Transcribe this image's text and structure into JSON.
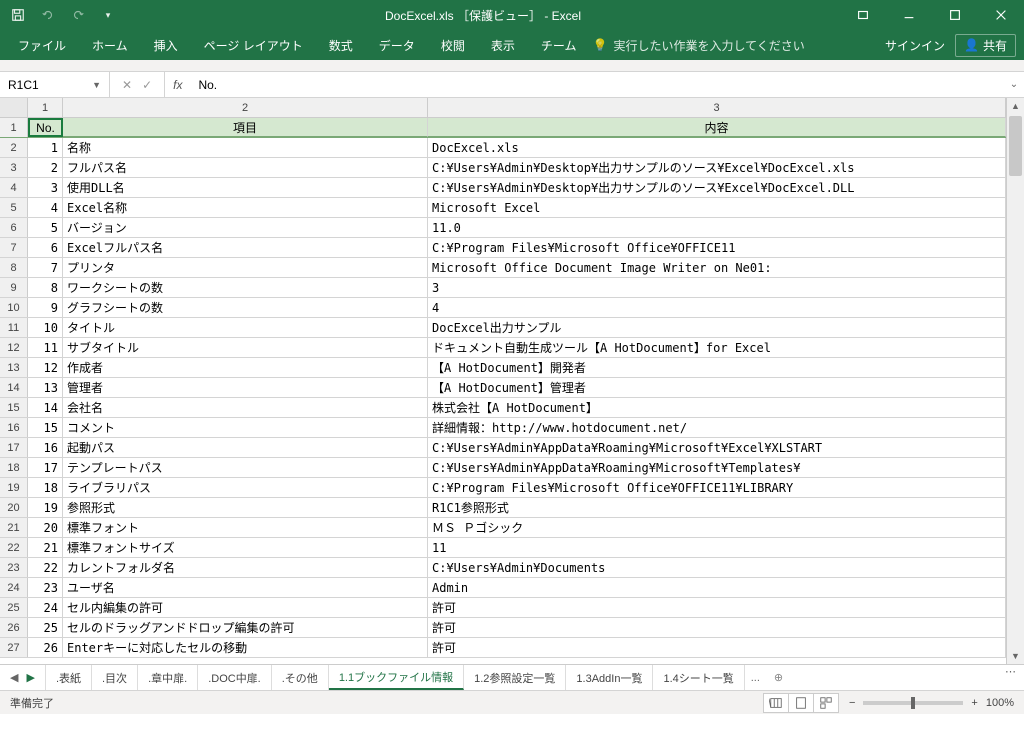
{
  "title": "DocExcel.xls ［保護ビュー］ - Excel",
  "qat": {
    "undo": "↶",
    "redo": "↷"
  },
  "tabs": [
    "ファイル",
    "ホーム",
    "挿入",
    "ページ レイアウト",
    "数式",
    "データ",
    "校閲",
    "表示",
    "チーム"
  ],
  "tell_me": "実行したい作業を入力してください",
  "signin": "サインイン",
  "share": "共有",
  "namebox": "R1C1",
  "fx_label": "fx",
  "formula": "No.",
  "col_headers": [
    "1",
    "2",
    "3"
  ],
  "header_row": {
    "no": "No.",
    "item": "項目",
    "content": "内容"
  },
  "rows": [
    {
      "n": "1",
      "item": "名称",
      "val": "DocExcel.xls"
    },
    {
      "n": "2",
      "item": "フルパス名",
      "val": "C:¥Users¥Admin¥Desktop¥出力サンプルのソース¥Excel¥DocExcel.xls"
    },
    {
      "n": "3",
      "item": "使用DLL名",
      "val": "C:¥Users¥Admin¥Desktop¥出力サンプルのソース¥Excel¥DocExcel.DLL"
    },
    {
      "n": "4",
      "item": "Excel名称",
      "val": "Microsoft Excel"
    },
    {
      "n": "5",
      "item": "バージョン",
      "val": "11.0"
    },
    {
      "n": "6",
      "item": "Excelフルパス名",
      "val": "C:¥Program Files¥Microsoft Office¥OFFICE11"
    },
    {
      "n": "7",
      "item": "プリンタ",
      "val": "Microsoft Office Document Image Writer on Ne01:"
    },
    {
      "n": "8",
      "item": "ワークシートの数",
      "val": "3"
    },
    {
      "n": "9",
      "item": "グラフシートの数",
      "val": "4"
    },
    {
      "n": "10",
      "item": "タイトル",
      "val": "DocExcel出力サンプル"
    },
    {
      "n": "11",
      "item": "サブタイトル",
      "val": "ドキュメント自動生成ツール【A HotDocument】for Excel"
    },
    {
      "n": "12",
      "item": "作成者",
      "val": "【A HotDocument】開発者"
    },
    {
      "n": "13",
      "item": "管理者",
      "val": "【A HotDocument】管理者"
    },
    {
      "n": "14",
      "item": "会社名",
      "val": "株式会社【A HotDocument】"
    },
    {
      "n": "15",
      "item": "コメント",
      "val": "詳細情報：http://www.hotdocument.net/"
    },
    {
      "n": "16",
      "item": "起動パス",
      "val": "C:¥Users¥Admin¥AppData¥Roaming¥Microsoft¥Excel¥XLSTART"
    },
    {
      "n": "17",
      "item": "テンプレートパス",
      "val": "C:¥Users¥Admin¥AppData¥Roaming¥Microsoft¥Templates¥"
    },
    {
      "n": "18",
      "item": "ライブラリパス",
      "val": "C:¥Program Files¥Microsoft Office¥OFFICE11¥LIBRARY"
    },
    {
      "n": "19",
      "item": "参照形式",
      "val": "R1C1参照形式"
    },
    {
      "n": "20",
      "item": "標準フォント",
      "val": "ＭＳ Ｐゴシック"
    },
    {
      "n": "21",
      "item": "標準フォントサイズ",
      "val": "11"
    },
    {
      "n": "22",
      "item": "カレントフォルダ名",
      "val": "C:¥Users¥Admin¥Documents"
    },
    {
      "n": "23",
      "item": "ユーザ名",
      "val": "Admin"
    },
    {
      "n": "24",
      "item": "セル内編集の許可",
      "val": "許可"
    },
    {
      "n": "25",
      "item": "セルのドラッグアンドドロップ編集の許可",
      "val": "許可"
    },
    {
      "n": "26",
      "item": "Enterキーに対応したセルの移動",
      "val": "許可"
    }
  ],
  "sheets": [
    ".表紙",
    ".目次",
    ".章中扉.",
    ".DOC中扉.",
    ".その他",
    "1.1ブックファイル情報",
    "1.2参照設定一覧",
    "1.3AddIn一覧",
    "1.4シート一覧"
  ],
  "active_sheet": 5,
  "sheet_more": "...",
  "status": "準備完了",
  "zoom": "100%"
}
